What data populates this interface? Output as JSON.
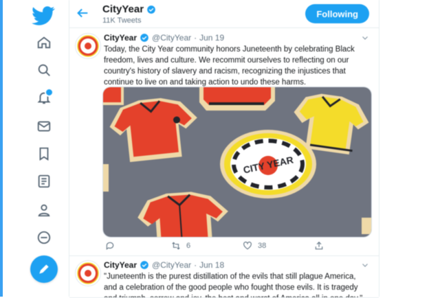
{
  "app": "Twitter",
  "colors": {
    "accent": "#1da1f2",
    "edge": "#3aa1f2",
    "text": "#14171a",
    "muted": "#657786",
    "cookie_red": "#e4412b",
    "cookie_yellow": "#f4dc2a",
    "tablecloth": "#6f7480"
  },
  "nav": {
    "items": [
      "home-icon",
      "explore-icon",
      "notifications-icon",
      "messages-icon",
      "bookmarks-icon",
      "lists-icon",
      "profile-icon",
      "more-icon"
    ],
    "compose_icon": "compose-tweet-icon"
  },
  "header": {
    "name": "CityYear",
    "tweet_count": "11K Tweets",
    "follow_label": "Following"
  },
  "tweets": [
    {
      "name": "CityYear",
      "handle": "@CityYear",
      "sep": "·",
      "date": "Jun 19",
      "text": "Today, the City Year community honors Juneteenth by celebrating Black freedom, lives and culture. We recommit ourselves to reflecting on our country's history of slavery and racism, recognizing the injustices that continue to live on and taking action to undo these harms.",
      "media": {
        "description": "cookies",
        "logo_text": "CITY YEAR"
      },
      "actions": {
        "reply": "",
        "retweet": "6",
        "like": "38",
        "share": ""
      }
    },
    {
      "name": "CityYear",
      "handle": "@CityYear",
      "sep": "·",
      "date": "Jun 18",
      "text": "\"Juneteenth is the purest distillation of the evils that still plague America, and a celebration of the good people who fought those evils. It is tragedy and triumph, sorrow and joy, the best and worst of America all in one day.\""
    }
  ]
}
